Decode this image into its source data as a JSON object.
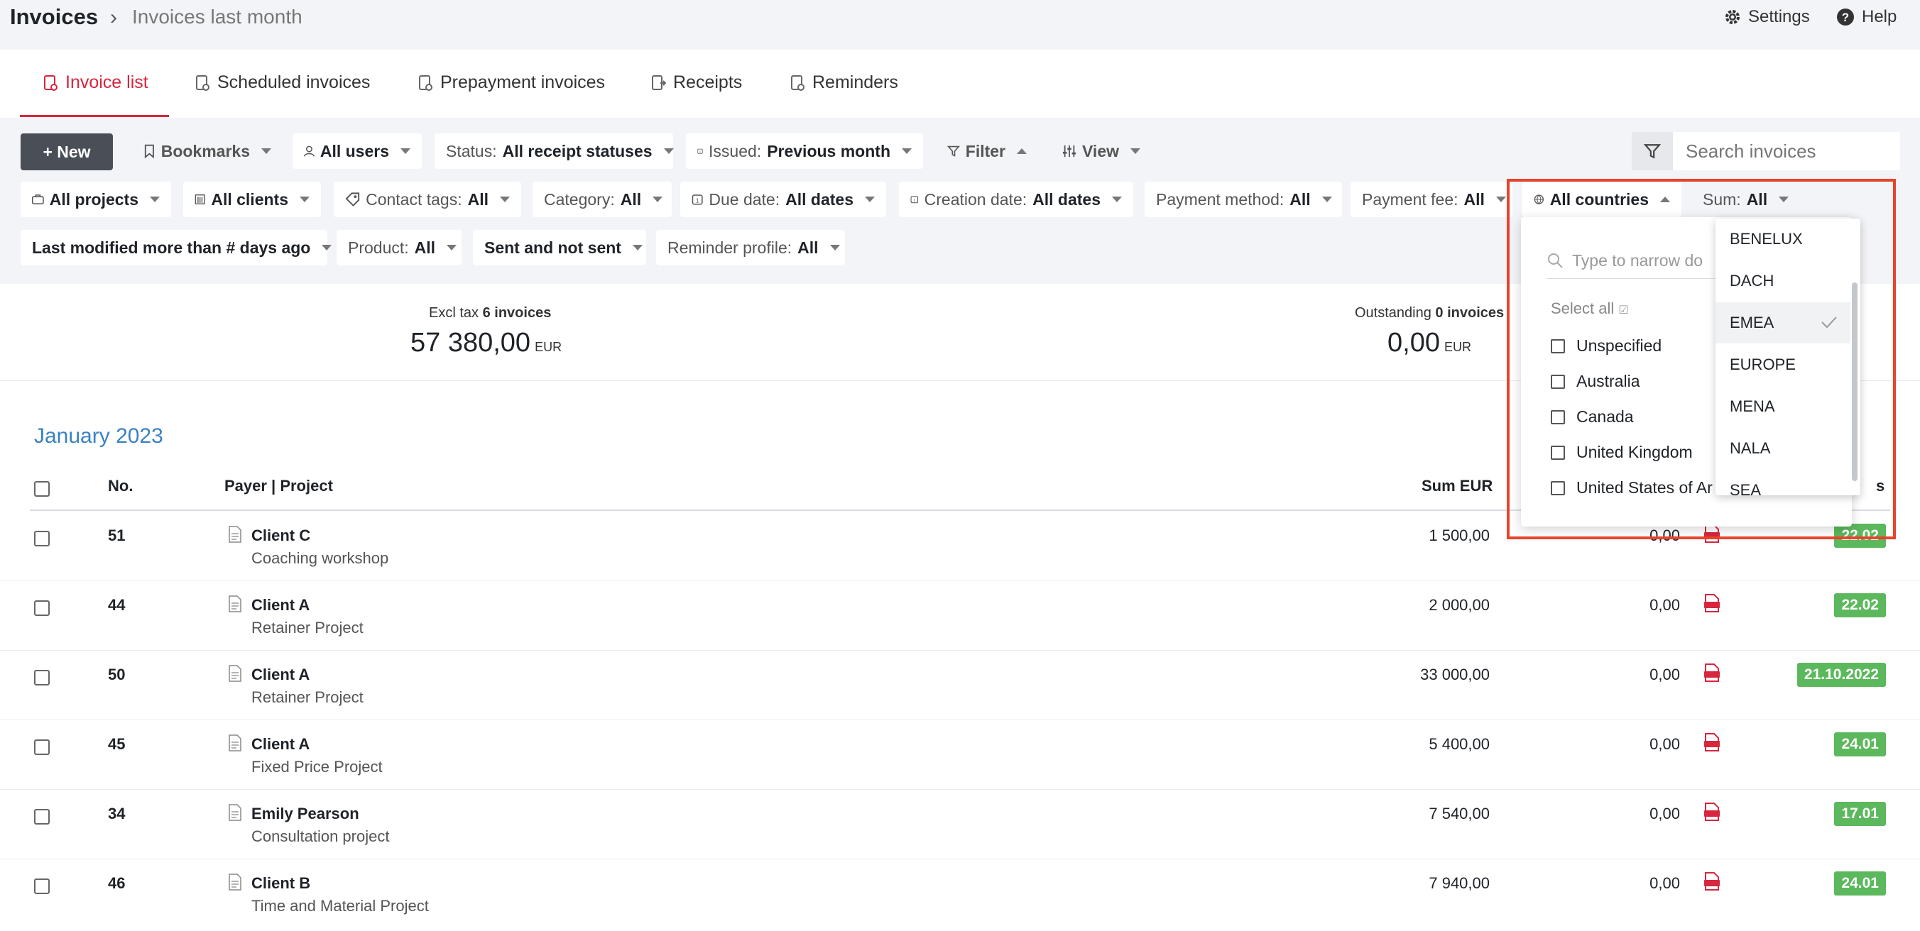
{
  "header": {
    "title": "Invoices",
    "separator": "›",
    "subtitle": "Invoices last month",
    "settings_label": "Settings",
    "help_label": "Help"
  },
  "tabs": [
    {
      "label": "Invoice list",
      "icon": "invoice-icon",
      "active": true
    },
    {
      "label": "Scheduled invoices",
      "icon": "schedule-icon"
    },
    {
      "label": "Prepayment invoices",
      "icon": "prepayment-icon"
    },
    {
      "label": "Receipts",
      "icon": "receipt-icon"
    },
    {
      "label": "Reminders",
      "icon": "reminder-icon"
    }
  ],
  "toolbar": {
    "new_label": "+ New",
    "bookmarks_label": "Bookmarks",
    "users_label": "All users",
    "status_prefix": "Status:",
    "status_value": "All receipt statuses",
    "issued_prefix": "Issued:",
    "issued_value": "Previous month",
    "filter_label": "Filter",
    "view_label": "View",
    "search_placeholder": "Search invoices"
  },
  "filters_row2": {
    "projects": "All projects",
    "clients": "All clients",
    "contact_tags_prefix": "Contact tags:",
    "contact_tags_value": "All",
    "category_prefix": "Category:",
    "category_value": "All",
    "due_prefix": "Due date:",
    "due_value": "All dates",
    "creation_prefix": "Creation date:",
    "creation_value": "All dates",
    "payment_method_prefix": "Payment method:",
    "payment_method_value": "All",
    "payment_fee_prefix": "Payment fee:",
    "payment_fee_value": "All",
    "countries": "All countries",
    "sum_prefix": "Sum:",
    "sum_value": "All"
  },
  "filters_row3": {
    "last_modified": "Last modified more than # days ago",
    "product_prefix": "Product:",
    "product_value": "All",
    "sent": "Sent and not sent",
    "reminder_prefix": "Reminder profile:",
    "reminder_value": "All"
  },
  "summary": {
    "excl_label": "Excl tax",
    "excl_count": "6 invoices",
    "excl_value": "57 380,00",
    "excl_currency": "EUR",
    "out_label": "Outstanding",
    "out_count": "0 invoices",
    "out_value": "0,00",
    "out_currency": "EUR"
  },
  "month_heading": "January 2023",
  "table": {
    "col_no": "No.",
    "col_payer": "Payer | Project",
    "col_sum": "Sum EUR",
    "col_status_partial": "s",
    "rows": [
      {
        "no": "51",
        "client": "Client C",
        "project": "Coaching workshop",
        "sum": "1 500,00",
        "outstanding": "0,00",
        "date": "22.02"
      },
      {
        "no": "44",
        "client": "Client A",
        "project": "Retainer Project",
        "sum": "2 000,00",
        "outstanding": "0,00",
        "date": "22.02"
      },
      {
        "no": "50",
        "client": "Client A",
        "project": "Retainer Project",
        "sum": "33 000,00",
        "outstanding": "0,00",
        "date": "21.10.2022"
      },
      {
        "no": "45",
        "client": "Client A",
        "project": "Fixed Price Project",
        "sum": "5 400,00",
        "outstanding": "0,00",
        "date": "24.01"
      },
      {
        "no": "34",
        "client": "Emily Pearson",
        "project": "Consultation project",
        "sum": "7 540,00",
        "outstanding": "0,00",
        "date": "17.01"
      },
      {
        "no": "46",
        "client": "Client B",
        "project": "Time and Material Project",
        "sum": "7 940,00",
        "outstanding": "0,00",
        "date": "24.01"
      }
    ]
  },
  "country_dropdown": {
    "search_placeholder": "Type to narrow do",
    "select_all": "Select all",
    "items": [
      "Unspecified",
      "Australia",
      "Canada",
      "United Kingdom",
      "United States of Ar"
    ]
  },
  "region_list": {
    "items": [
      "BENELUX",
      "DACH",
      "EMEA",
      "EUROPE",
      "MENA",
      "NALA",
      "SEA"
    ],
    "selected": "EMEA"
  },
  "colors": {
    "accent": "#d7263d",
    "link": "#3b82c4",
    "badge": "#5cb85c",
    "highlight": "#e8432c"
  }
}
